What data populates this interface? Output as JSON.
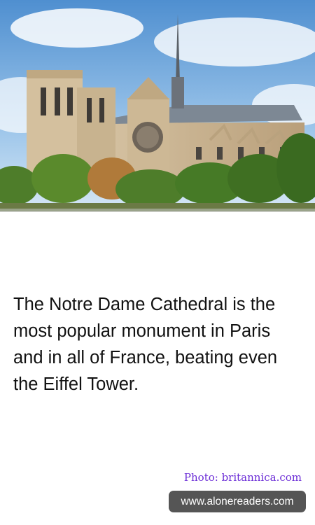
{
  "image": {
    "subject": "cathedral-photo",
    "sky_color": "#7fb3e0",
    "stone_color": "#c9b495",
    "roof_color": "#7d8894",
    "tree_color": "#4e7d2a"
  },
  "fact": {
    "text": "The Notre Dame Cathedral is the most popular monument in Paris and in all of France, beating even the Eiffel Tower."
  },
  "credit": {
    "text": "Photo: britannica.com",
    "color": "#6a2bd6"
  },
  "badge": {
    "text": "www.alonereaders.com"
  }
}
